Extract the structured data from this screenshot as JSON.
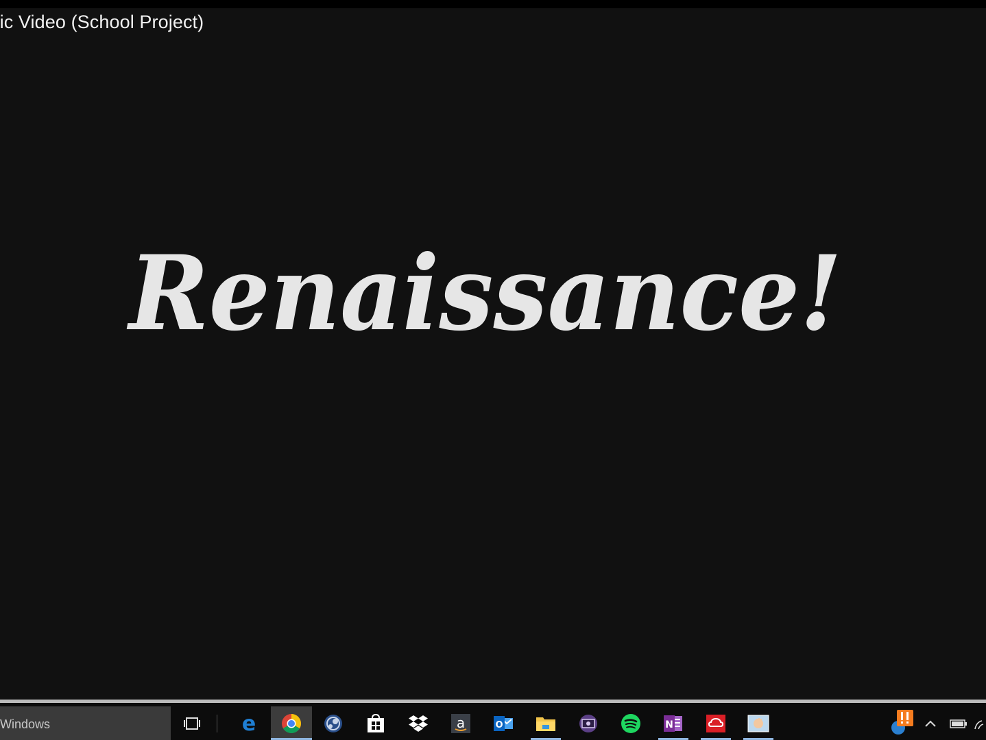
{
  "video": {
    "title": "sic Video (School Project)",
    "frame_text": "Renaissance!"
  },
  "progress": {
    "fraction": 1.0
  },
  "taskbar": {
    "search_placeholder": "Windows",
    "pinned_icons": [
      "task-view-icon",
      "edge-icon",
      "chrome-icon",
      "steam-icon",
      "store-icon",
      "dropbox-icon",
      "amazon-icon",
      "outlook-icon",
      "file-explorer-icon",
      "media-player-icon",
      "spotify-icon",
      "onenote-icon",
      "creative-cloud-icon",
      "paint-icon"
    ],
    "active_app": "chrome-icon",
    "tray_icons": [
      "notification-alert-icon",
      "show-hidden-icons-chevron",
      "battery-icon",
      "wifi-icon"
    ]
  },
  "colors": {
    "edge": "#1f7fd4",
    "chrome_red": "#db4437",
    "chrome_yellow": "#f4c20d",
    "chrome_green": "#0f9d58",
    "spotify": "#1ed760",
    "onenote": "#7b2e97",
    "creative_cloud": "#da1f26",
    "outlook": "#0a64c1",
    "alert": "#f57c1f"
  }
}
